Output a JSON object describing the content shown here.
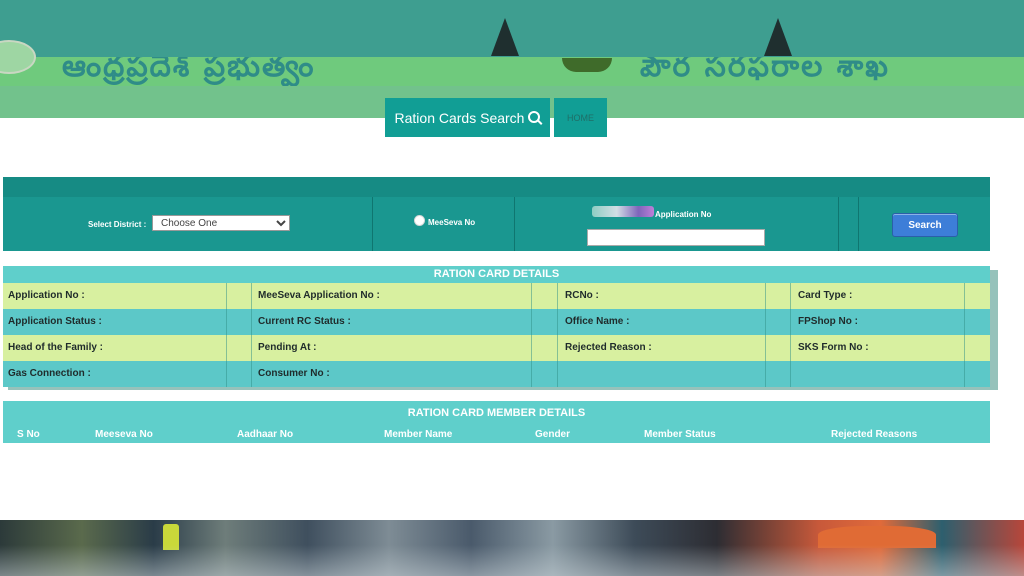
{
  "header": {
    "left_title": "ఆంధ్రప్రదేశ్ ప్రభుత్వం",
    "right_title": "పౌర సరఫరాల శాఖ"
  },
  "nav": {
    "search_label": "Ration Cards Search",
    "search_icon": "search-icon",
    "home_label": "HOME"
  },
  "search_form": {
    "district_label": "Select District :",
    "district_selected": "Choose One",
    "meeseva_label": "MeeSeva No",
    "application_label": "Application No",
    "application_value": "",
    "search_button": "Search"
  },
  "details": {
    "title": "RATION CARD DETAILS",
    "rows": [
      [
        "Application No :",
        "MeeSeva Application No :",
        "RCNo :",
        "Card Type :"
      ],
      [
        "Application Status :",
        "Current RC Status :",
        "Office Name :",
        "FPShop No :"
      ],
      [
        "Head of the Family :",
        "Pending At :",
        "Rejected Reason :",
        "SKS Form No :"
      ],
      [
        "Gas Connection :",
        "Consumer No :",
        "",
        ""
      ]
    ]
  },
  "members": {
    "title": "RATION CARD MEMBER DETAILS",
    "columns": [
      "S No",
      "Meeseva No",
      "Aadhaar No",
      "Member Name",
      "Gender",
      "Member Status",
      "Rejected Reasons"
    ]
  },
  "colors": {
    "topbar": "#3e9e90",
    "banner": "#6fca7d",
    "panel": "#1a9790",
    "row_light": "#d8f0a0",
    "row_cyan": "#5cc8c8",
    "search_button": "#3d7ed8"
  }
}
